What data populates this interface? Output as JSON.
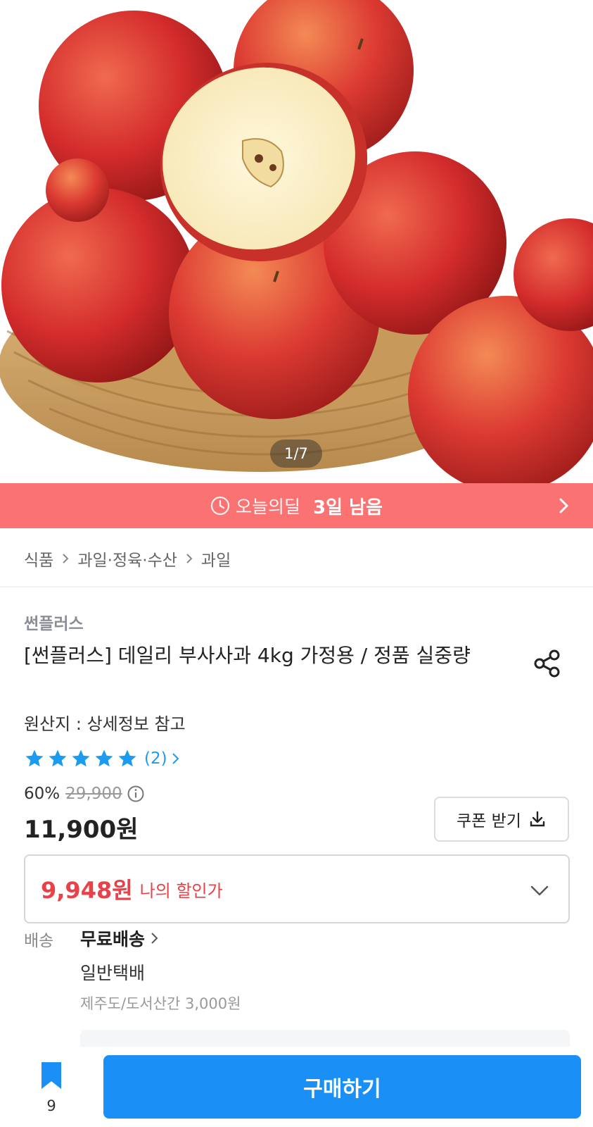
{
  "product_image": {
    "description_icon": "apple-basket-photo",
    "counter": "1/7"
  },
  "deal_banner": {
    "icon": "clock-icon",
    "label": "오늘의딜",
    "remaining": "3일 남음",
    "color": "#fb7272"
  },
  "breadcrumb": [
    "식품",
    "과일·정육·수산",
    "과일"
  ],
  "product": {
    "seller": "썬플러스",
    "title": "[썬플러스] 데일리 부사사과 4kg 가정용 / 정품 실중량",
    "origin": "원산지 : 상세정보 참고",
    "rating_stars": 5,
    "review_count": "(2)",
    "discount_rate": "60%",
    "original_price": "29,900",
    "price": "11,900원",
    "coupon_button": "쿠폰 받기",
    "my_price": "9,948원",
    "my_price_label": "나의 할인가"
  },
  "shipping": {
    "key": "배송",
    "value": "무료배송",
    "type": "일반택배",
    "extra": "제주도/도서산간 3,000원"
  },
  "bottom_bar": {
    "bookmark_count": "9",
    "buy_button": "구매하기",
    "accent_color": "#1a8ff5"
  }
}
